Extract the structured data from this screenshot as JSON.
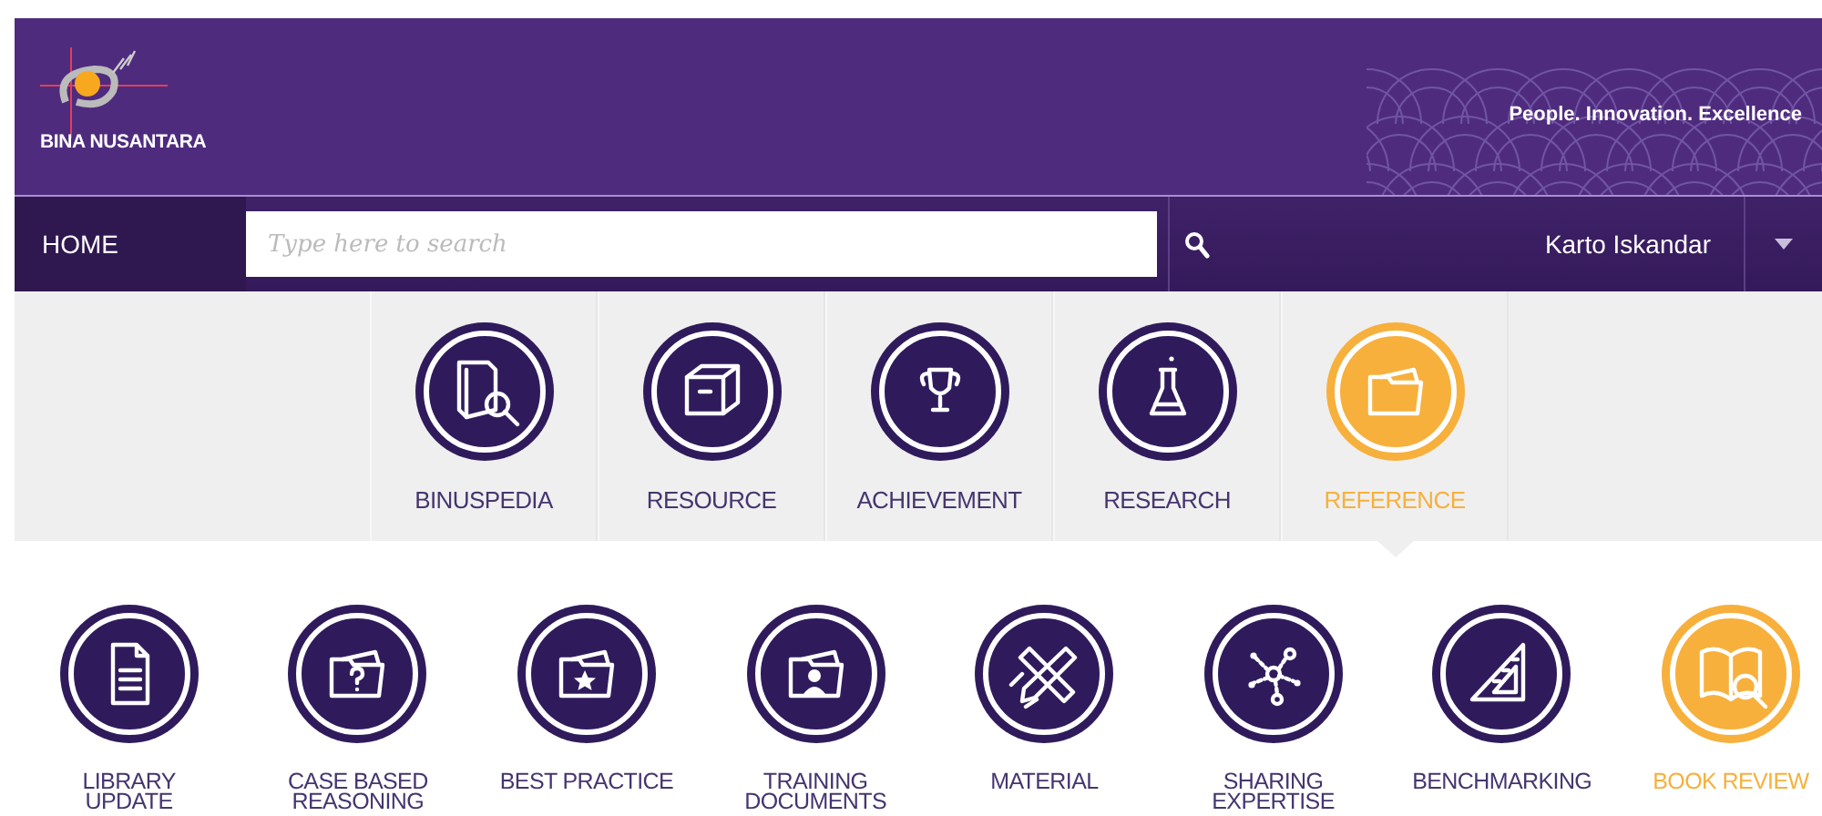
{
  "header": {
    "logo_text": "BINA NUSANTARA",
    "tagline": "People. Innovation. Excellence"
  },
  "nav": {
    "home": "HOME",
    "search": {
      "placeholder": "Type here to search"
    },
    "user": "Karto Iskandar"
  },
  "categories": [
    {
      "label": "BINUSPEDIA",
      "selected": false
    },
    {
      "label": "RESOURCE",
      "selected": false
    },
    {
      "label": "ACHIEVEMENT",
      "selected": false
    },
    {
      "label": "RESEARCH",
      "selected": false
    },
    {
      "label": "REFERENCE",
      "selected": true
    }
  ],
  "subcategories": [
    {
      "label": "LIBRARY UPDATE",
      "selected": false
    },
    {
      "label": "CASE BASED REASONING",
      "selected": false
    },
    {
      "label": "BEST PRACTICE",
      "selected": false
    },
    {
      "label": "TRAINING DOCUMENTS",
      "selected": false
    },
    {
      "label": "MATERIAL",
      "selected": false
    },
    {
      "label": "SHARING EXPERTISE",
      "selected": false
    },
    {
      "label": "BENCHMARKING",
      "selected": false
    },
    {
      "label": "BOOK REVIEW",
      "selected": true
    }
  ]
}
